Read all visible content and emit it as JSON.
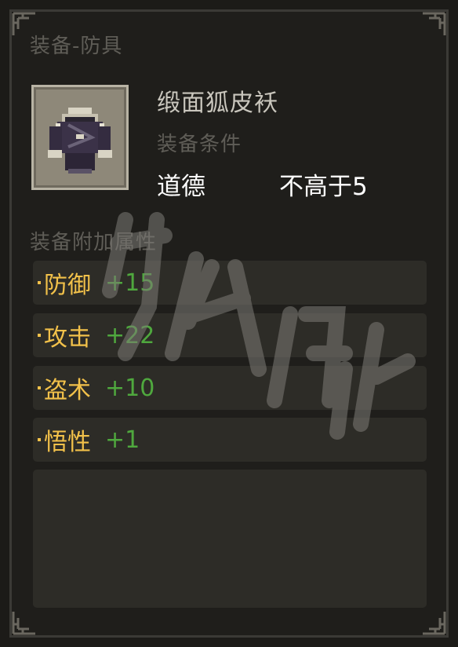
{
  "tooltip": {
    "category": "装备-防具",
    "item_name": "缎面狐皮袄",
    "condition_title": "装备条件",
    "condition": {
      "attribute": "道德",
      "requirement": "不高于5"
    },
    "bonus_title": "装备附加属性",
    "bonuses": [
      {
        "name": "防御",
        "value": "+15"
      },
      {
        "name": "攻击",
        "value": "+22"
      },
      {
        "name": "盗术",
        "value": "+10"
      },
      {
        "name": "悟性",
        "value": "+1"
      }
    ],
    "icon": "fur-coat-icon"
  },
  "colors": {
    "background": "#1f1e1b",
    "muted_text": "#5f5d57",
    "attribute_gold": "#f2c14a",
    "value_green": "#4fa83e",
    "row_bg": "#2d2c27"
  }
}
